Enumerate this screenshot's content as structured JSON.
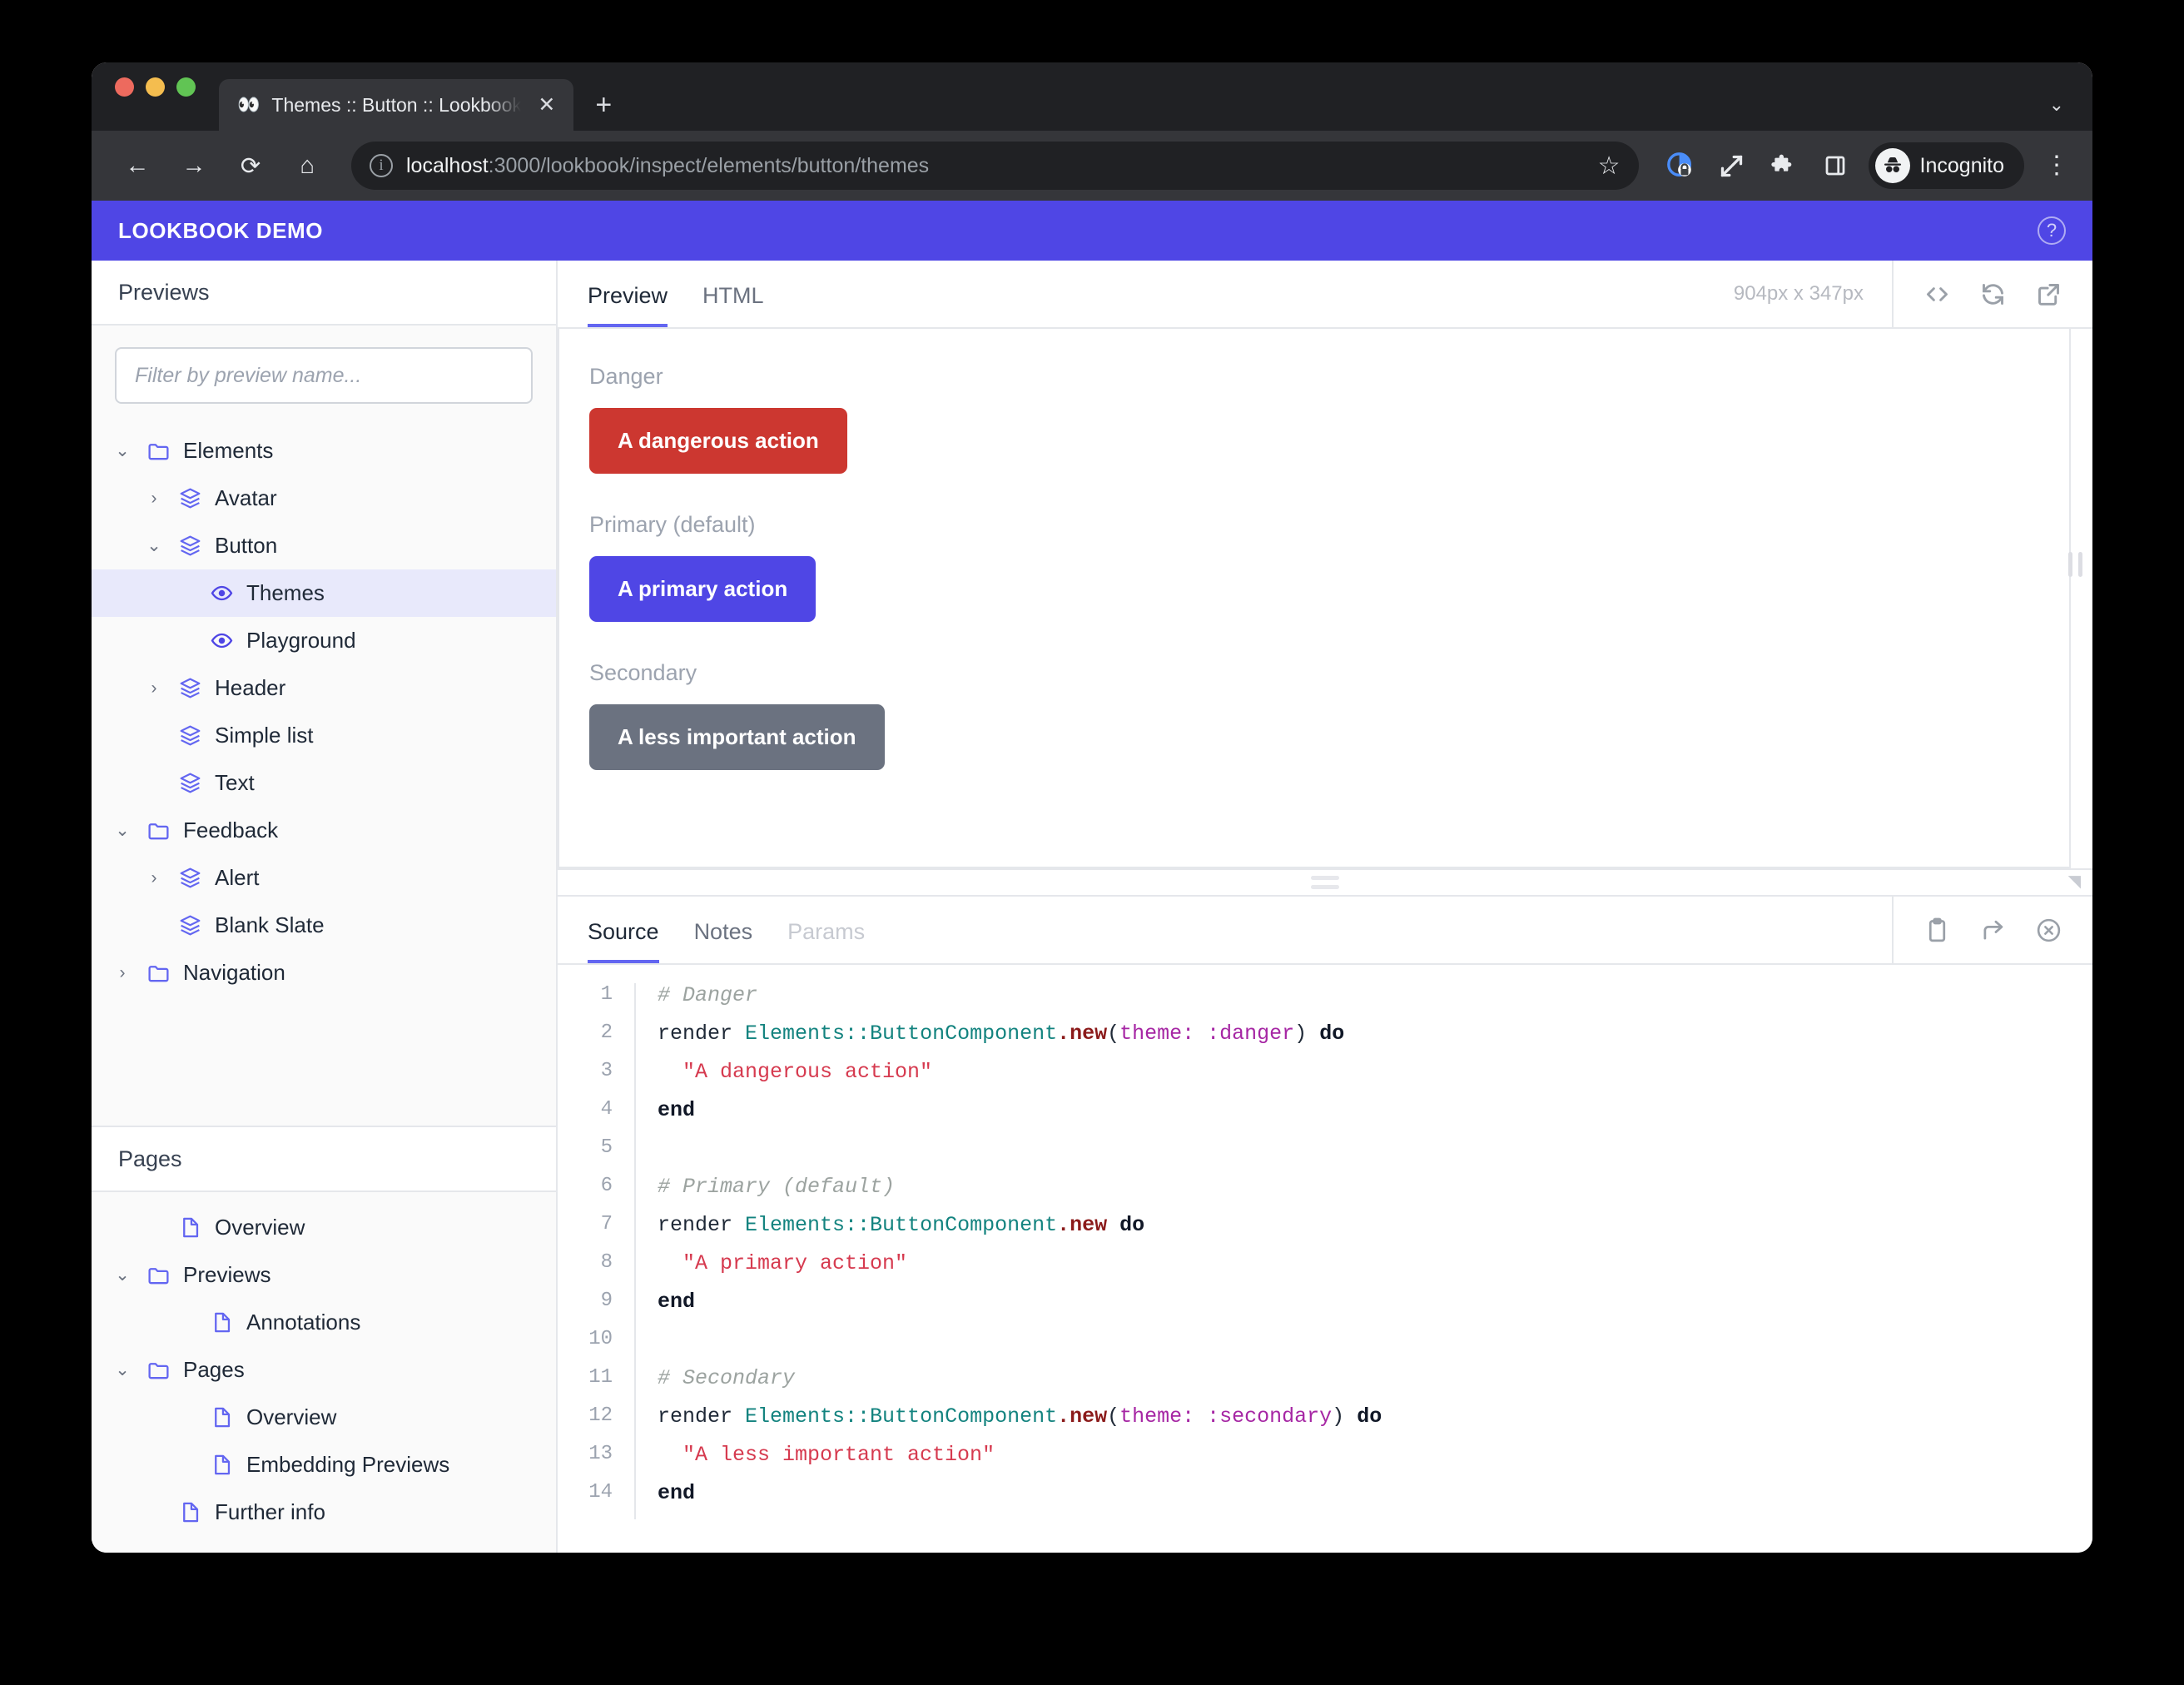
{
  "browser": {
    "tab": {
      "title": "Themes :: Button :: Lookbook D",
      "icon": "👀",
      "close_label": "✕"
    },
    "new_tab_label": "+",
    "tabstrip_chevron": "⌄",
    "nav": {
      "back": "←",
      "forward": "→",
      "reload": "⟳",
      "home": "⌂"
    },
    "url": {
      "host": "localhost",
      "rest": ":3000/lookbook/inspect/elements/button/themes",
      "info_glyph": "i"
    },
    "star_label": "☆",
    "profile_label": "Incognito",
    "menu_label": "⋮"
  },
  "app": {
    "brand": "LOOKBOOK DEMO",
    "help_label": "?"
  },
  "sidebar": {
    "previews_title": "Previews",
    "filter_placeholder": "Filter by preview name...",
    "tree": [
      {
        "label": "Elements",
        "icon": "folder-icon",
        "arrow": "⌄",
        "indent": 0,
        "selected": false
      },
      {
        "label": "Avatar",
        "icon": "layers-icon",
        "arrow": "›",
        "indent": 1,
        "selected": false
      },
      {
        "label": "Button",
        "icon": "layers-icon",
        "arrow": "⌄",
        "indent": 1,
        "selected": false
      },
      {
        "label": "Themes",
        "icon": "eye-icon",
        "arrow": "",
        "indent": 2,
        "selected": true
      },
      {
        "label": "Playground",
        "icon": "eye-icon",
        "arrow": "",
        "indent": 2,
        "selected": false
      },
      {
        "label": "Header",
        "icon": "layers-icon",
        "arrow": "›",
        "indent": 1,
        "selected": false
      },
      {
        "label": "Simple list",
        "icon": "layers-icon",
        "arrow": "",
        "indent": 1,
        "selected": false
      },
      {
        "label": "Text",
        "icon": "layers-icon",
        "arrow": "",
        "indent": 1,
        "selected": false
      },
      {
        "label": "Feedback",
        "icon": "folder-icon",
        "arrow": "⌄",
        "indent": 0,
        "selected": false
      },
      {
        "label": "Alert",
        "icon": "layers-icon",
        "arrow": "›",
        "indent": 1,
        "selected": false
      },
      {
        "label": "Blank Slate",
        "icon": "layers-icon",
        "arrow": "",
        "indent": 1,
        "selected": false
      },
      {
        "label": "Navigation",
        "icon": "folder-icon",
        "arrow": "›",
        "indent": 0,
        "selected": false
      }
    ],
    "pages_title": "Pages",
    "pages_tree": [
      {
        "label": "Overview",
        "icon": "document-icon",
        "arrow": "",
        "indent": 1
      },
      {
        "label": "Previews",
        "icon": "folder-icon",
        "arrow": "⌄",
        "indent": 0
      },
      {
        "label": "Annotations",
        "icon": "document-icon",
        "arrow": "",
        "indent": 2
      },
      {
        "label": "Pages",
        "icon": "folder-icon",
        "arrow": "⌄",
        "indent": 0
      },
      {
        "label": "Overview",
        "icon": "document-icon",
        "arrow": "",
        "indent": 2
      },
      {
        "label": "Embedding Previews",
        "icon": "document-icon",
        "arrow": "",
        "indent": 2
      },
      {
        "label": "Further info",
        "icon": "document-icon",
        "arrow": "",
        "indent": 1
      }
    ]
  },
  "preview_panel": {
    "tabs": [
      {
        "label": "Preview",
        "state": "active"
      },
      {
        "label": "HTML",
        "state": "normal"
      }
    ],
    "dimensions": "904px x 347px",
    "actions": [
      "code-icon",
      "refresh-icon",
      "open-external-icon"
    ],
    "examples": [
      {
        "label": "Danger",
        "button_text": "A dangerous action",
        "color": "#cc3730"
      },
      {
        "label": "Primary (default)",
        "button_text": "A primary action",
        "color": "#4f46e5"
      },
      {
        "label": "Secondary",
        "button_text": "A less important action",
        "color": "#6b7280"
      }
    ]
  },
  "source_panel": {
    "tabs": [
      {
        "label": "Source",
        "state": "active"
      },
      {
        "label": "Notes",
        "state": "normal"
      },
      {
        "label": "Params",
        "state": "disabled"
      }
    ],
    "actions": [
      "clipboard-icon",
      "share-icon",
      "close-circle-icon"
    ],
    "code_lines": [
      {
        "n": "1",
        "tokens": [
          {
            "t": "# Danger",
            "c": "c-com"
          }
        ]
      },
      {
        "n": "2",
        "tokens": [
          {
            "t": "render ",
            "c": ""
          },
          {
            "t": "Elements::ButtonComponent",
            "c": "c-const"
          },
          {
            "t": ".new",
            "c": "c-meth"
          },
          {
            "t": "(",
            "c": ""
          },
          {
            "t": "theme: :danger",
            "c": "c-sym"
          },
          {
            "t": ") ",
            "c": ""
          },
          {
            "t": "do",
            "c": "c-kw"
          }
        ]
      },
      {
        "n": "3",
        "tokens": [
          {
            "t": "  \"A dangerous action\"",
            "c": "c-str"
          }
        ]
      },
      {
        "n": "4",
        "tokens": [
          {
            "t": "end",
            "c": "c-kw"
          }
        ]
      },
      {
        "n": "5",
        "tokens": [
          {
            "t": "",
            "c": ""
          }
        ]
      },
      {
        "n": "6",
        "tokens": [
          {
            "t": "# Primary (default)",
            "c": "c-com"
          }
        ]
      },
      {
        "n": "7",
        "tokens": [
          {
            "t": "render ",
            "c": ""
          },
          {
            "t": "Elements::ButtonComponent",
            "c": "c-const"
          },
          {
            "t": ".new",
            "c": "c-meth"
          },
          {
            "t": " ",
            "c": ""
          },
          {
            "t": "do",
            "c": "c-kw"
          }
        ]
      },
      {
        "n": "8",
        "tokens": [
          {
            "t": "  \"A primary action\"",
            "c": "c-str"
          }
        ]
      },
      {
        "n": "9",
        "tokens": [
          {
            "t": "end",
            "c": "c-kw"
          }
        ]
      },
      {
        "n": "10",
        "tokens": [
          {
            "t": "",
            "c": ""
          }
        ]
      },
      {
        "n": "11",
        "tokens": [
          {
            "t": "# Secondary",
            "c": "c-com"
          }
        ]
      },
      {
        "n": "12",
        "tokens": [
          {
            "t": "render ",
            "c": ""
          },
          {
            "t": "Elements::ButtonComponent",
            "c": "c-const"
          },
          {
            "t": ".new",
            "c": "c-meth"
          },
          {
            "t": "(",
            "c": ""
          },
          {
            "t": "theme: :secondary",
            "c": "c-sym"
          },
          {
            "t": ") ",
            "c": ""
          },
          {
            "t": "do",
            "c": "c-kw"
          }
        ]
      },
      {
        "n": "13",
        "tokens": [
          {
            "t": "  \"A less important action\"",
            "c": "c-str"
          }
        ]
      },
      {
        "n": "14",
        "tokens": [
          {
            "t": "end",
            "c": "c-kw"
          }
        ]
      }
    ]
  }
}
